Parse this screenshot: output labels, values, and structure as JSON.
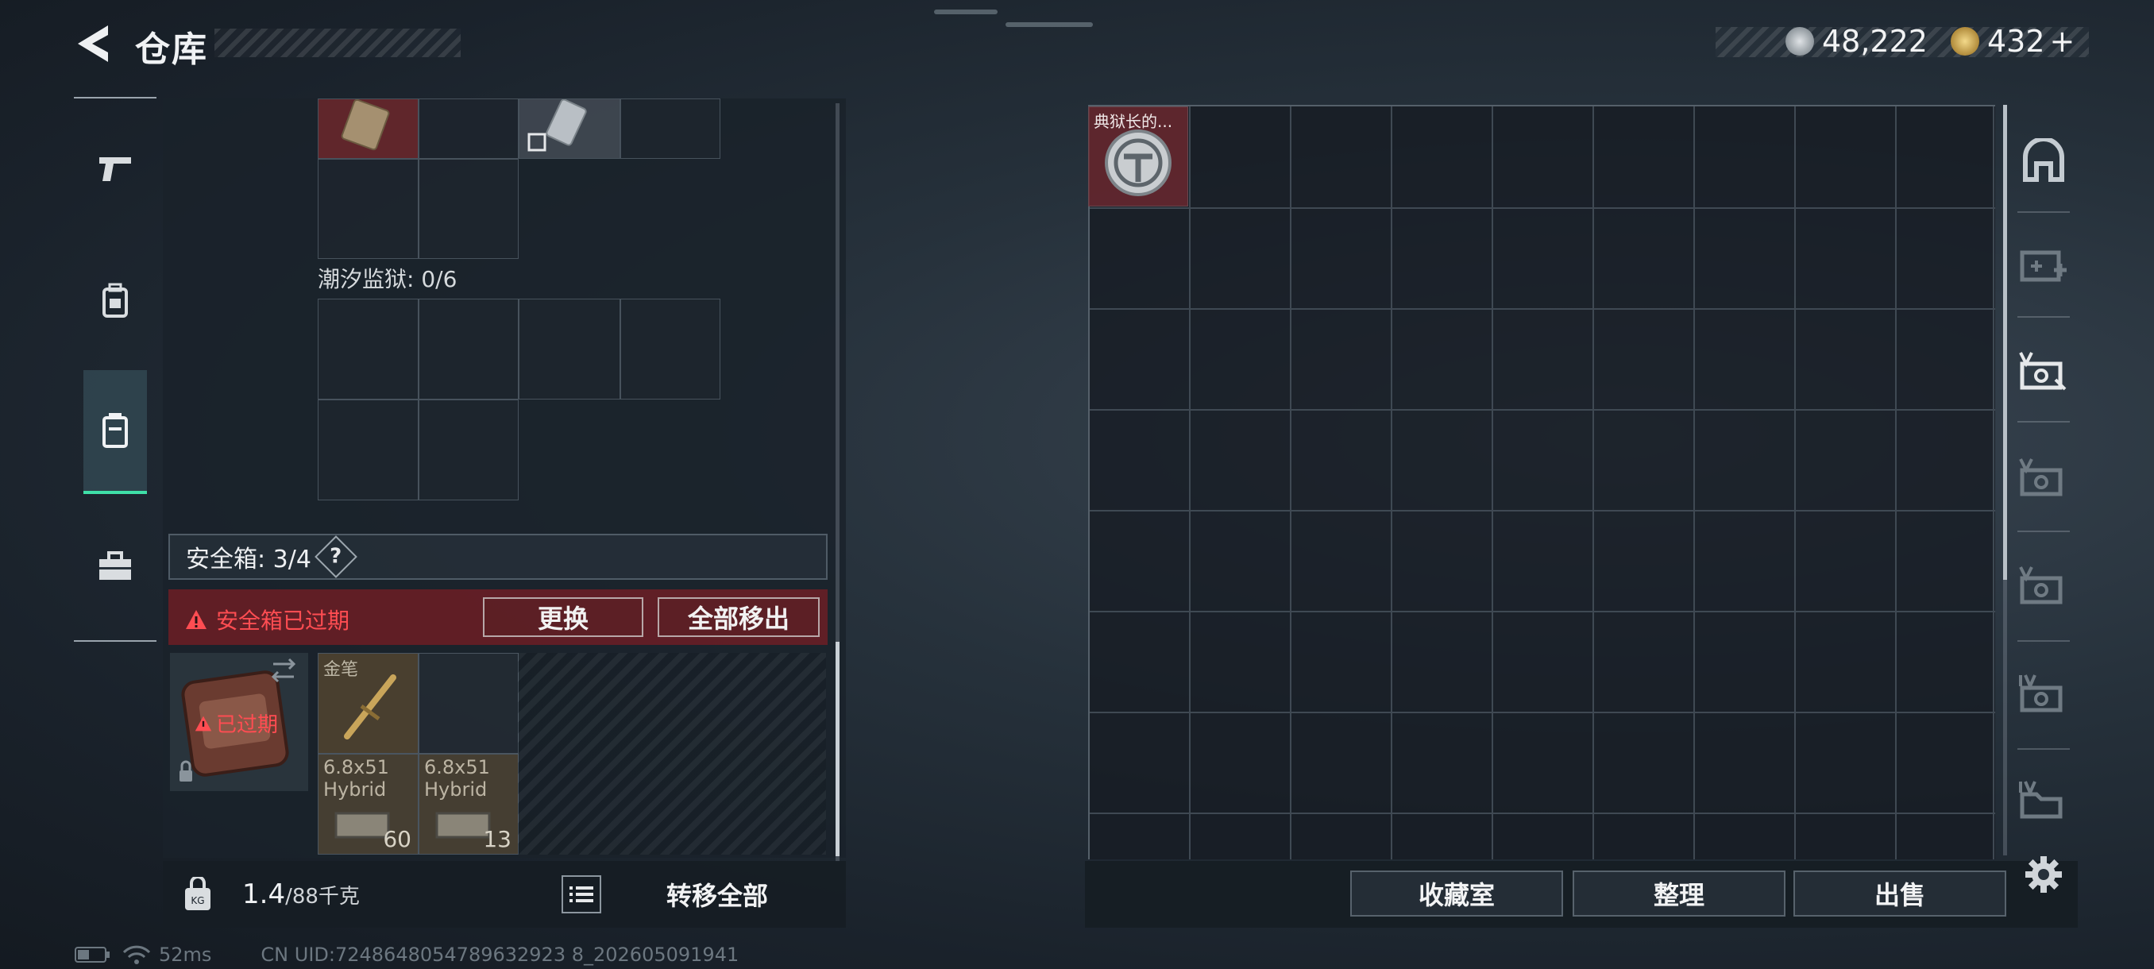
{
  "header": {
    "title": "仓库",
    "silver_amount": "48,222",
    "gold_amount": "432",
    "gold_plus": "+"
  },
  "nav": {
    "items": [
      {
        "name": "weapons",
        "icon": "pistol-icon"
      },
      {
        "name": "armor",
        "icon": "backpack-icon"
      },
      {
        "name": "containers",
        "icon": "safebox-icon",
        "selected": true
      },
      {
        "name": "tools",
        "icon": "toolbox-icon"
      }
    ]
  },
  "left_panel": {
    "prison_label": "潮汐监狱: 0/6",
    "safebox_label": "安全箱: 3/4",
    "help_label": "?",
    "expired_warning": "安全箱已过期",
    "replace_button": "更换",
    "move_all_out_button": "全部移出",
    "safebox_expired_tag": "已过期",
    "items": [
      {
        "name": "金笔",
        "count": ""
      },
      {
        "name": "6.8x51 Hybrid",
        "count": "60"
      },
      {
        "name": "6.8x51 Hybrid",
        "count": "13"
      }
    ],
    "footer": {
      "weight_current": "1.4",
      "weight_max": "/88千克",
      "transfer_all_button": "转移全部"
    }
  },
  "right_panel": {
    "warden_item_label": "典狱长的...",
    "buttons": {
      "collection": "收藏室",
      "organize": "整理",
      "sell": "出售"
    },
    "tabs": [
      "storage-tab-icon",
      "storage-add-icon",
      "storage-v-icon",
      "storage-v-icon",
      "storage-v-icon",
      "storage-iv-icon",
      "storage-iv-icon"
    ]
  },
  "status": {
    "ping": "52ms",
    "uid": "CN UID:7248648054789632923 8_202605091941"
  },
  "colors": {
    "accent_green": "#3fe0a8",
    "warning_red": "#ff4d52"
  }
}
